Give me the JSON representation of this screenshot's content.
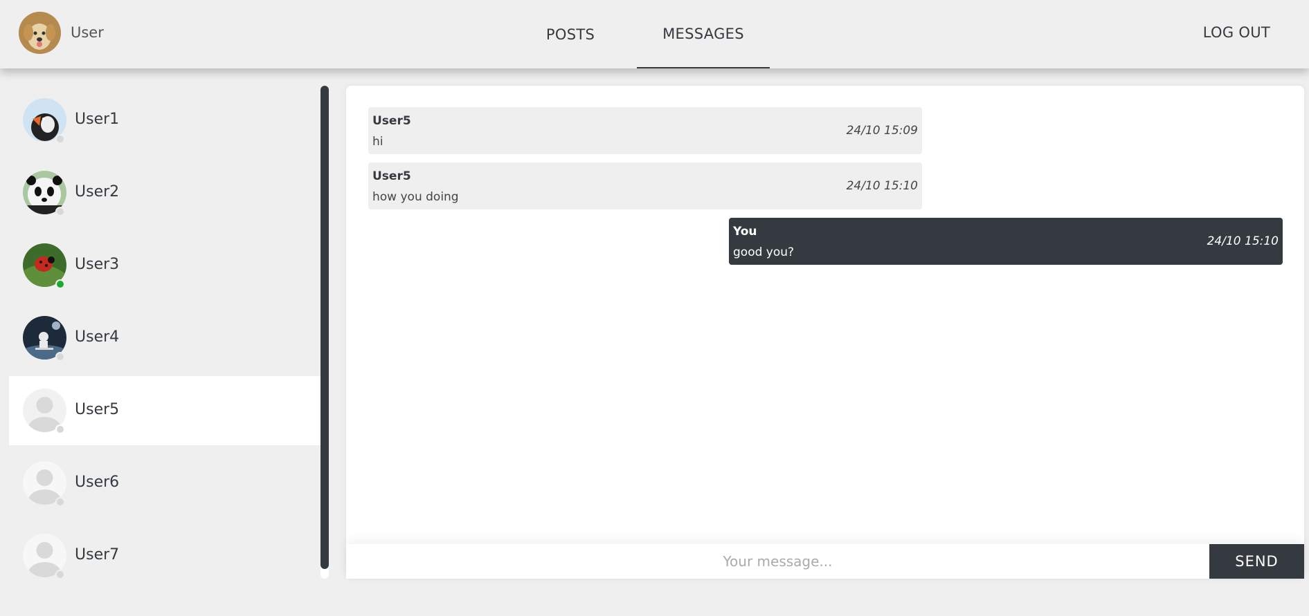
{
  "header": {
    "user_name": "User",
    "nav": {
      "posts": "POSTS",
      "messages": "MESSAGES"
    },
    "logout": "LOG OUT"
  },
  "sidebar": {
    "users": [
      {
        "name": "User1",
        "online": false,
        "avatar": "puffin-avatar"
      },
      {
        "name": "User2",
        "online": false,
        "avatar": "panda-avatar"
      },
      {
        "name": "User3",
        "online": true,
        "avatar": "ladybug-avatar"
      },
      {
        "name": "User4",
        "online": false,
        "avatar": "astronaut-avatar"
      },
      {
        "name": "User5",
        "online": false,
        "avatar": "default-avatar",
        "active": true
      },
      {
        "name": "User6",
        "online": false,
        "avatar": "default-avatar"
      },
      {
        "name": "User7",
        "online": false,
        "avatar": "default-avatar"
      }
    ]
  },
  "chat": {
    "messages": [
      {
        "sender": "User5",
        "text": "hi",
        "time": "24/10 15:09",
        "direction": "in"
      },
      {
        "sender": "User5",
        "text": "how you doing",
        "time": "24/10 15:10",
        "direction": "in"
      },
      {
        "sender": "You",
        "text": "good you?",
        "time": "24/10 15:10",
        "direction": "out"
      }
    ],
    "input_placeholder": "Your message...",
    "send_label": "SEND"
  },
  "colors": {
    "primary": "#343a40",
    "background": "#efefef",
    "online": "#1ea830",
    "offline": "#d8d8d8"
  }
}
